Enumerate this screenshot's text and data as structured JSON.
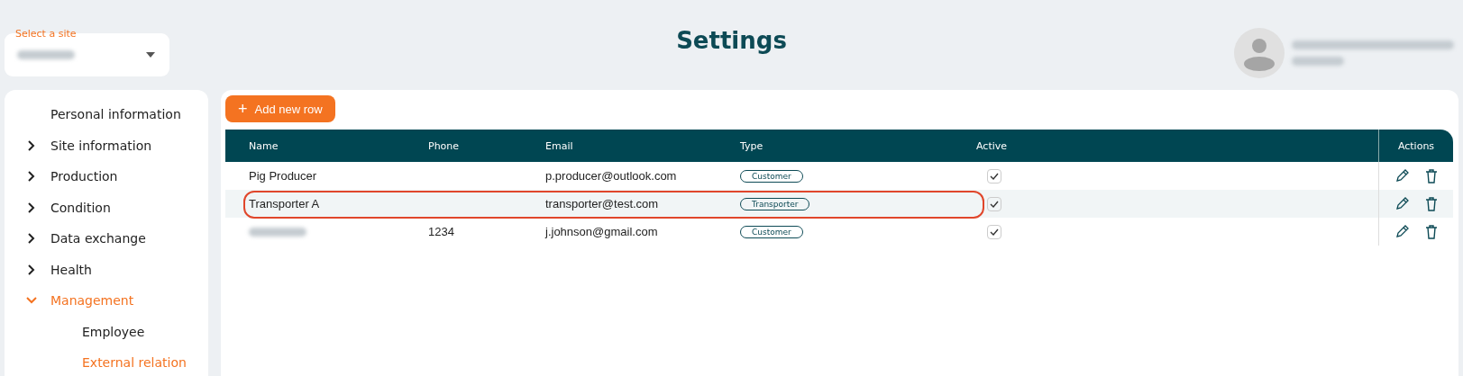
{
  "site_select": {
    "label": "Select a site"
  },
  "title": "Settings",
  "sidebar": {
    "items": [
      {
        "label": "Personal information",
        "selected": false
      },
      {
        "label": "Site information",
        "expanded": false,
        "selected": false
      },
      {
        "label": "Production",
        "expanded": false,
        "selected": false
      },
      {
        "label": "Condition",
        "expanded": false,
        "selected": false
      },
      {
        "label": "Data exchange",
        "expanded": false,
        "selected": false
      },
      {
        "label": "Health",
        "expanded": false,
        "selected": false
      },
      {
        "label": "Management",
        "expanded": true,
        "selected": true,
        "children": [
          {
            "label": "Employee",
            "selected": false
          },
          {
            "label": "External relation",
            "selected": true
          }
        ]
      }
    ]
  },
  "add_button": {
    "label": "Add new row",
    "icon": "+"
  },
  "table": {
    "columns": [
      "Name",
      "Phone",
      "Email",
      "Type",
      "Active",
      "Actions"
    ],
    "rows": [
      {
        "name": "Pig Producer",
        "email": "p.producer@outlook.com",
        "type": "Customer",
        "active": true,
        "highlighted": false
      },
      {
        "name": "Transporter A",
        "email": "transporter@test.com",
        "type": "Transporter",
        "active": true,
        "highlighted": true
      },
      {
        "phone": "1234",
        "email": "j.johnson@gmail.com",
        "type": "Customer",
        "active": true,
        "highlighted": false
      }
    ]
  }
}
